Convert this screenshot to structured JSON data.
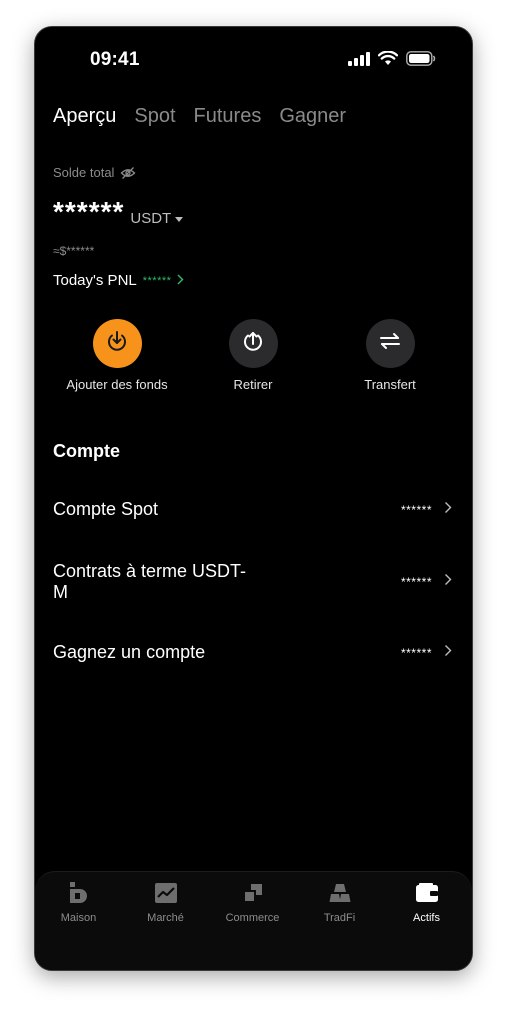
{
  "status_bar": {
    "time": "09:41"
  },
  "tabs": [
    {
      "label": "Aperçu",
      "active": true
    },
    {
      "label": "Spot",
      "active": false
    },
    {
      "label": "Futures",
      "active": false
    },
    {
      "label": "Gagner",
      "active": false
    }
  ],
  "balance": {
    "label": "Solde total",
    "value": "******",
    "currency": "USDT",
    "approx": "≈$******"
  },
  "pnl": {
    "label": "Today's PNL",
    "value": "******"
  },
  "actions": [
    {
      "label": "Ajouter des fonds",
      "icon": "download-icon",
      "color": "#f7931a"
    },
    {
      "label": "Retirer",
      "icon": "upload-icon",
      "color": "#2b2b2d"
    },
    {
      "label": "Transfert",
      "icon": "transfer-icon",
      "color": "#2b2b2d"
    }
  ],
  "section": {
    "title": "Compte"
  },
  "accounts": [
    {
      "name": "Compte Spot",
      "value": "******"
    },
    {
      "name": "Contrats à terme USDT-\nM",
      "value": "******"
    },
    {
      "name": "Gagnez un compte",
      "value": "******"
    }
  ],
  "bottom_nav": [
    {
      "label": "Maison",
      "icon": "home-logo-icon",
      "active": false
    },
    {
      "label": "Marché",
      "icon": "market-chart-icon",
      "active": false
    },
    {
      "label": "Commerce",
      "icon": "trade-icon",
      "active": false
    },
    {
      "label": "TradFi",
      "icon": "gold-bars-icon",
      "active": false
    },
    {
      "label": "Actifs",
      "icon": "wallet-icon",
      "active": true
    }
  ],
  "colors": {
    "accent": "#f7931a",
    "positive": "#2ebd6b",
    "background": "#000000"
  }
}
